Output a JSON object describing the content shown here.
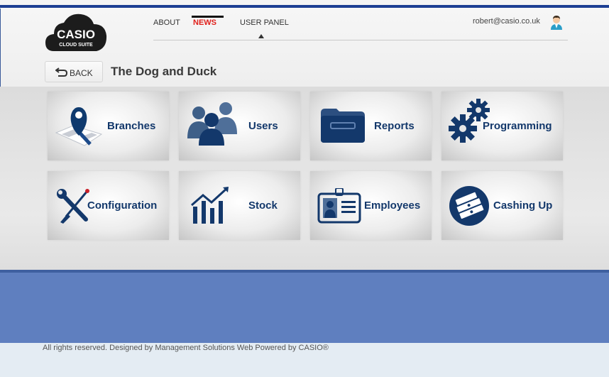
{
  "header": {
    "logo": {
      "brand": "CASIO",
      "sub": "CLOUD SUITE"
    },
    "nav": [
      {
        "label": "ABOUT",
        "active": false
      },
      {
        "label": "NEWS",
        "active": true
      },
      {
        "label": "USER PANEL",
        "active": false
      }
    ],
    "user": {
      "email": "robert@casio.co.uk",
      "icon": "user-avatar-icon"
    }
  },
  "page": {
    "back_label": "BACK",
    "title": "The Dog and Duck"
  },
  "tiles": [
    {
      "label": "Branches",
      "icon": "map-pin-icon"
    },
    {
      "label": "Users",
      "icon": "users-icon"
    },
    {
      "label": "Reports",
      "icon": "folder-icon"
    },
    {
      "label": "Programming",
      "icon": "gears-icon"
    },
    {
      "label": "Configuration",
      "icon": "wrench-screwdriver-icon"
    },
    {
      "label": "Stock",
      "icon": "bar-chart-icon"
    },
    {
      "label": "Employees",
      "icon": "id-badge-icon"
    },
    {
      "label": "Cashing Up",
      "icon": "cash-icon"
    }
  ],
  "footer": {
    "text": "All rights reserved. Designed by Management Solutions Web Powered by CASIO®"
  },
  "colors": {
    "navy": "#13386b",
    "blue_band": "#5f7fbf",
    "top_stripe": "#1d3f93",
    "news_red": "#e0201b"
  }
}
